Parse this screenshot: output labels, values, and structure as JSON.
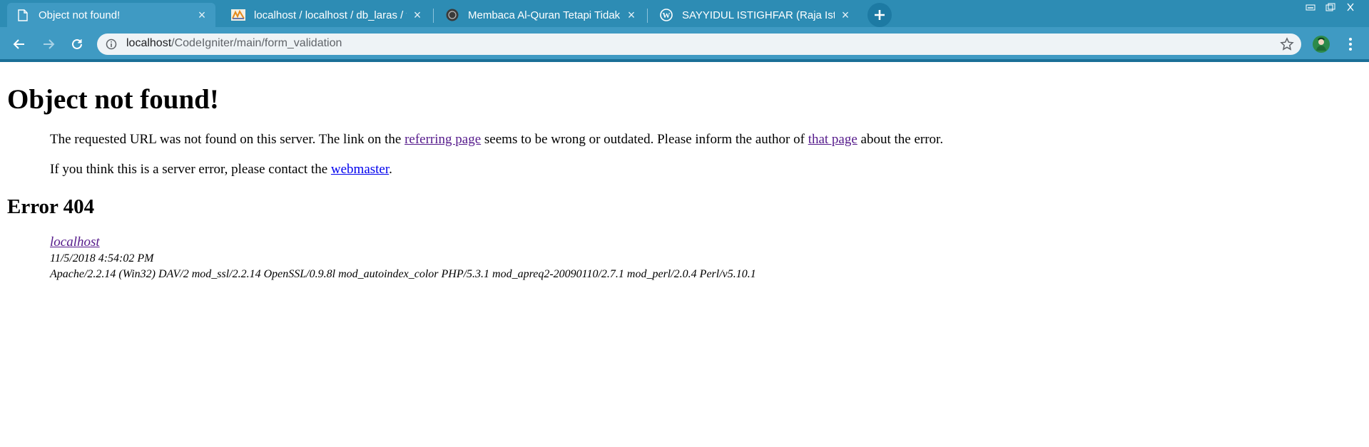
{
  "tabs": [
    {
      "title": "Object not found!",
      "active": true,
      "icon": "page-icon"
    },
    {
      "title": "localhost / localhost / db_laras / t",
      "active": false,
      "icon": "phpmyadmin-icon"
    },
    {
      "title": "Membaca Al-Quran Tetapi Tidak",
      "active": false,
      "icon": "site-icon"
    },
    {
      "title": "SAYYIDUL ISTIGHFAR (Raja Istigh",
      "active": false,
      "icon": "wordpress-icon"
    }
  ],
  "address_bar": {
    "host": "localhost",
    "path": "/CodeIgniter/main/form_validation"
  },
  "page": {
    "heading": "Object not found!",
    "p1_before": "The requested URL was not found on this server. The link on the ",
    "p1_link1": "referring page",
    "p1_mid": " seems to be wrong or outdated. Please inform the author of ",
    "p1_link2": "that page",
    "p1_after": " about the error.",
    "p2_before": "If you think this is a server error, please contact the ",
    "p2_link": "webmaster",
    "p2_after": ".",
    "error_heading": "Error 404",
    "address_host": "localhost",
    "address_date": "11/5/2018 4:54:02 PM",
    "address_server": "Apache/2.2.14 (Win32) DAV/2 mod_ssl/2.2.14 OpenSSL/0.9.8l mod_autoindex_color PHP/5.3.1 mod_apreq2-20090110/2.7.1 mod_perl/2.0.4 Perl/v5.10.1"
  },
  "colors": {
    "tabstrip": "#2d8cb4",
    "toolbar": "#3f9ac3",
    "link": "#0000ee",
    "visited_link": "#551a8b"
  }
}
